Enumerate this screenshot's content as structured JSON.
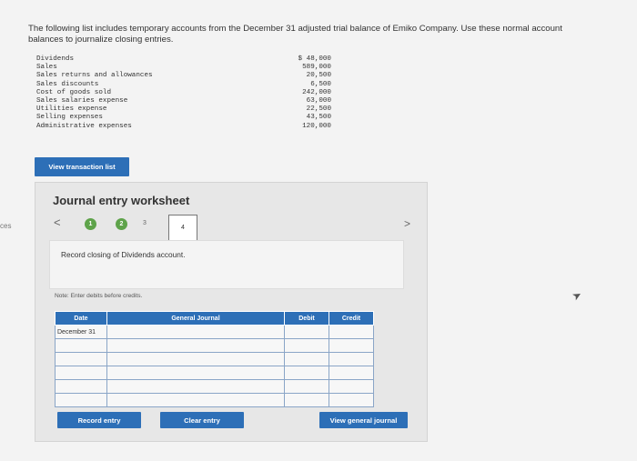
{
  "side_text": "ces",
  "intro": "The following list includes temporary accounts from the December 31 adjusted trial balance of Emiko Company. Use these normal account balances to journalize closing entries.",
  "accounts": [
    {
      "name": "Dividends",
      "amount": "$ 48,000"
    },
    {
      "name": "Sales",
      "amount": "589,000"
    },
    {
      "name": "Sales returns and allowances",
      "amount": "20,500"
    },
    {
      "name": "Sales discounts",
      "amount": "6,500"
    },
    {
      "name": "Cost of goods sold",
      "amount": "242,000"
    },
    {
      "name": "Sales salaries expense",
      "amount": "63,000"
    },
    {
      "name": "Utilities expense",
      "amount": "22,500"
    },
    {
      "name": "Selling expenses",
      "amount": "43,500"
    },
    {
      "name": "Administrative expenses",
      "amount": "120,000"
    }
  ],
  "buttons": {
    "view_transaction_list": "View transaction list",
    "record_entry": "Record entry",
    "clear_entry": "Clear entry",
    "view_general_journal": "View general journal"
  },
  "worksheet": {
    "title": "Journal entry worksheet",
    "steps": [
      "1",
      "2",
      "3",
      "4"
    ],
    "nav_prev": "<",
    "nav_next": ">",
    "instruction": "Record closing of Dividends account.",
    "note": "Note: Enter debits before credits.",
    "table": {
      "headers": [
        "Date",
        "General Journal",
        "Debit",
        "Credit"
      ],
      "first_date": "December 31"
    }
  }
}
